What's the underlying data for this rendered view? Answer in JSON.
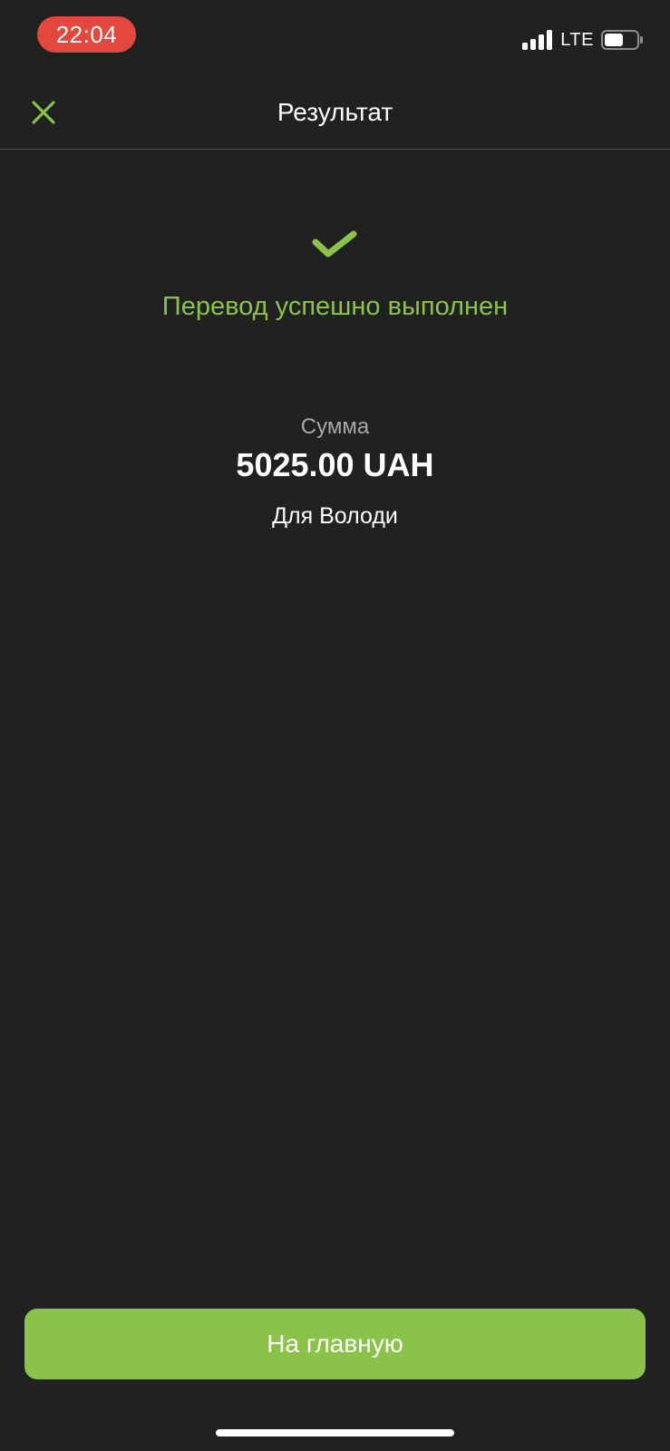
{
  "status_bar": {
    "time": "22:04",
    "network": "LTE",
    "signal_icon": "cellular-signal-icon",
    "battery_icon": "battery-icon",
    "time_pill_color": "#e2483d"
  },
  "header": {
    "title": "Результат",
    "close_icon": "close-icon"
  },
  "result": {
    "status_icon": "checkmark-icon",
    "message": "Перевод успешно выполнен",
    "amount_label": "Сумма",
    "amount_value": "5025.00 UAH",
    "recipient": "Для Володи"
  },
  "footer": {
    "home_button_label": "На главную"
  },
  "colors": {
    "background": "#212121",
    "accent": "#8bc34a",
    "text_primary": "#ffffff",
    "text_secondary": "#a8a8a8",
    "divider": "#4a4a4a"
  }
}
